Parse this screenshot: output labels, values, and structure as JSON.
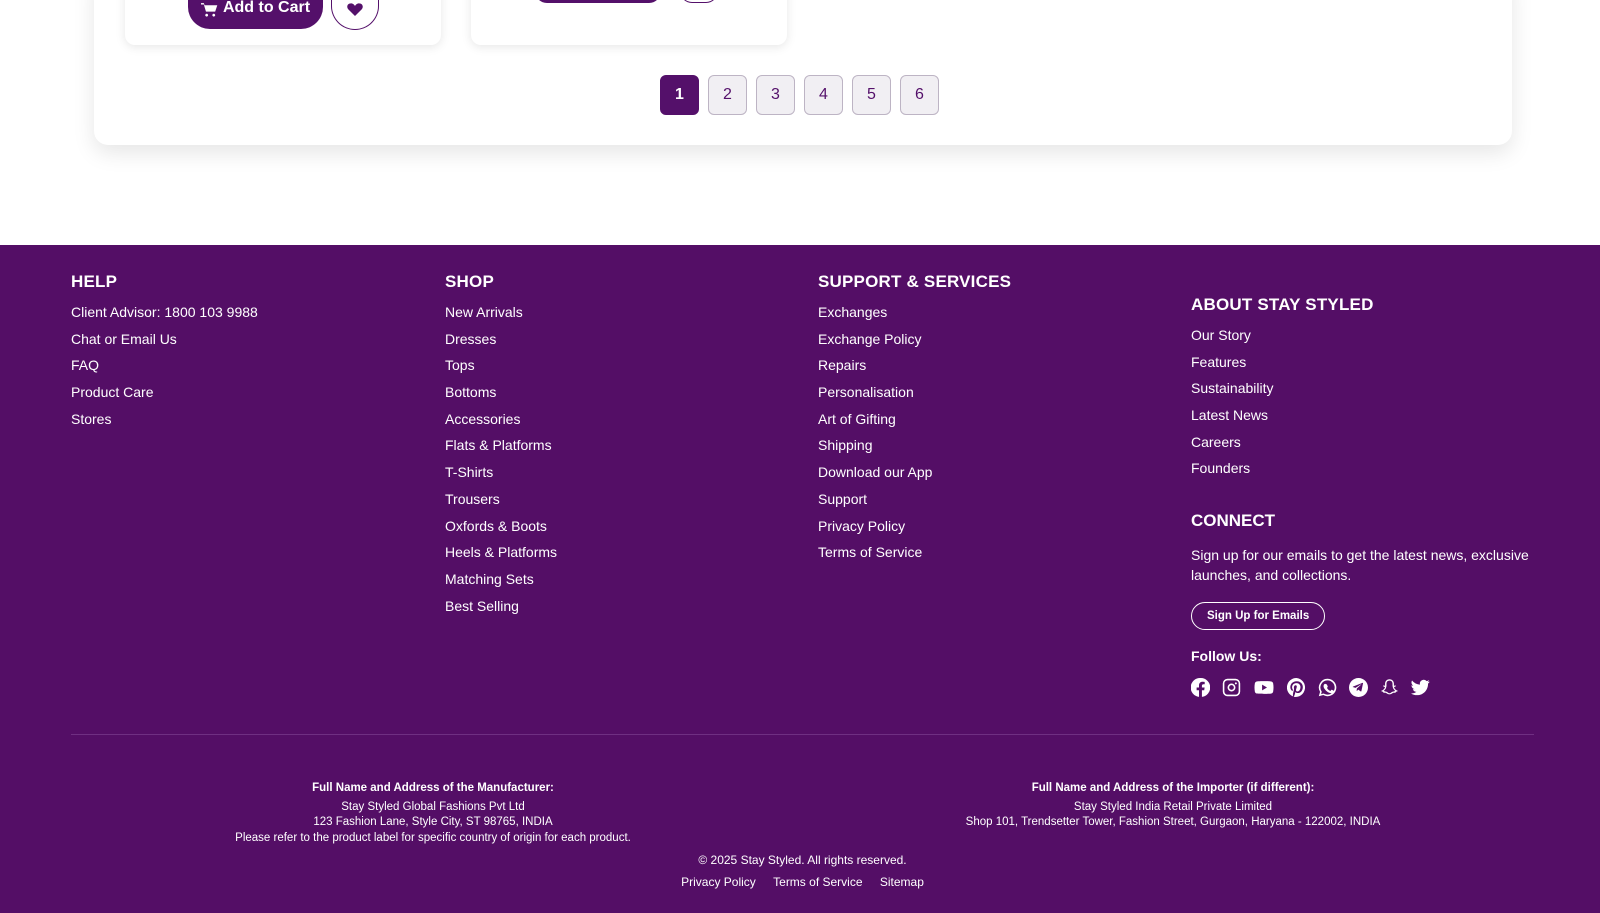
{
  "product_cards": [
    {
      "add_to_cart_label": "Add to Cart"
    },
    {
      "add_to_cart_label": ""
    }
  ],
  "pagination": {
    "pages": [
      "1",
      "2",
      "3",
      "4",
      "5",
      "6"
    ],
    "active_page": "1"
  },
  "footer": {
    "help": {
      "title": "HELP",
      "items": [
        "Client Advisor: 1800 103 9988",
        "Chat or Email Us",
        "FAQ",
        "Product Care",
        "Stores"
      ]
    },
    "shop": {
      "title": "SHOP",
      "items": [
        "New Arrivals",
        "Dresses",
        "Tops",
        "Bottoms",
        "Accessories",
        "Flats & Platforms",
        "T-Shirts",
        "Trousers",
        "Oxfords & Boots",
        "Heels & Platforms",
        "Matching Sets",
        "Best Selling"
      ]
    },
    "support": {
      "title": "SUPPORT & SERVICES",
      "items": [
        "Exchanges",
        "Exchange Policy",
        "Repairs",
        "Personalisation",
        "Art of Gifting",
        "Shipping",
        "Download our App",
        "Support",
        "Privacy Policy",
        "Terms of Service"
      ]
    },
    "about": {
      "title": "ABOUT STAY STYLED",
      "items": [
        "Our Story",
        "Features",
        "Sustainability",
        "Latest News",
        "Careers",
        "Founders"
      ]
    },
    "connect": {
      "title": "CONNECT",
      "text": "Sign up for our emails to get the latest news, exclusive launches, and collections.",
      "signup_label": "Sign Up for Emails",
      "follow_label": "Follow Us:",
      "social_icons": [
        "facebook-icon",
        "instagram-icon",
        "youtube-icon",
        "pinterest-icon",
        "whatsapp-icon",
        "telegram-icon",
        "snapchat-icon",
        "twitter-icon"
      ]
    },
    "manufacturer": {
      "heading": "Full Name and Address of the Manufacturer:",
      "line1": "Stay Styled Global Fashions Pvt Ltd",
      "line2": "123 Fashion Lane, Style City, ST 98765, INDIA",
      "line3": "Please refer to the product label for specific country of origin for each product."
    },
    "importer": {
      "heading": "Full Name and Address of the Importer (if different):",
      "line1": "Stay Styled India Retail Private Limited",
      "line2": "Shop 101, Trendsetter Tower, Fashion Street, Gurgaon, Haryana - 122002, INDIA"
    },
    "copyright": "© 2025 Stay Styled. All rights reserved.",
    "bottom_links": [
      "Privacy Policy",
      "Terms of Service",
      "Sitemap"
    ]
  },
  "colors": {
    "brand_purple": "#540e66",
    "white": "#ffffff"
  }
}
